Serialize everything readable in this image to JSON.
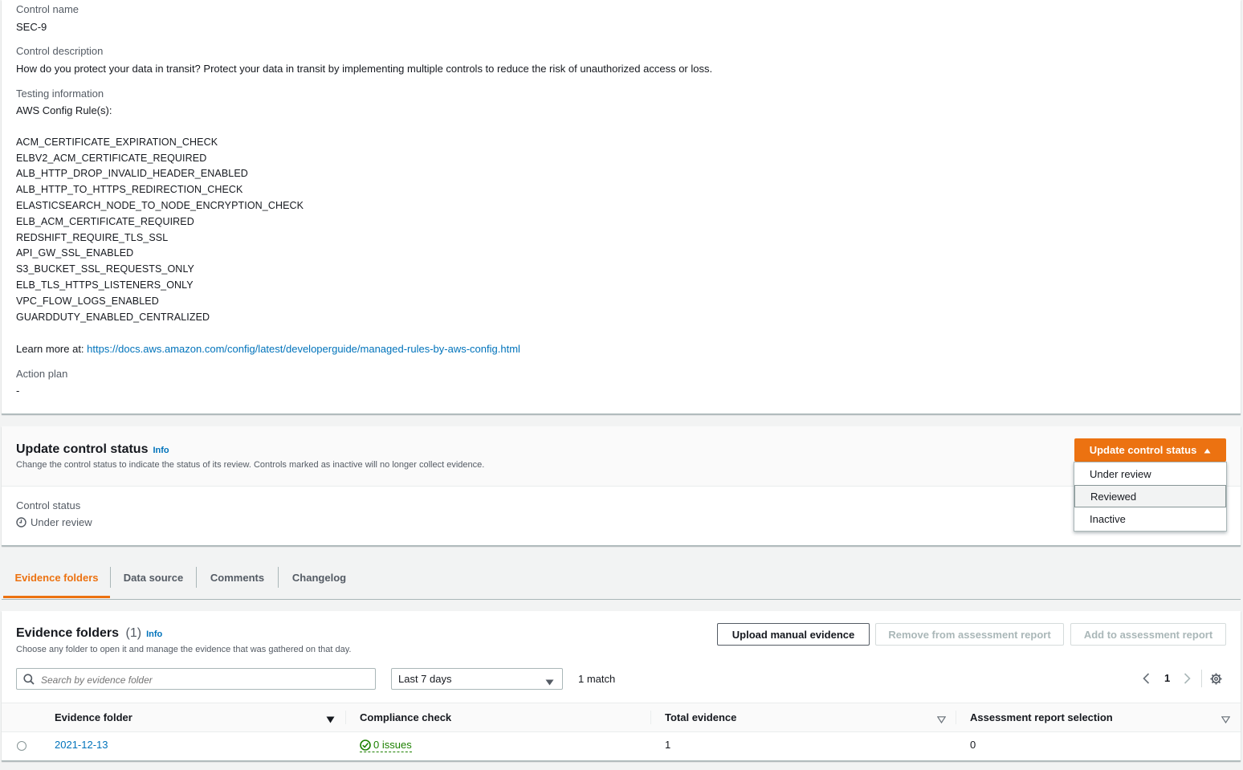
{
  "details": {
    "control_name_label": "Control name",
    "control_name": "SEC-9",
    "description_label": "Control description",
    "description": "How do you protect your data in transit? Protect your data in transit by implementing multiple controls to reduce the risk of unauthorized access or loss.",
    "testing_label": "Testing information",
    "config_rules_label": "AWS Config Rule(s):",
    "rules": [
      "ACM_CERTIFICATE_EXPIRATION_CHECK",
      "ELBV2_ACM_CERTIFICATE_REQUIRED",
      "ALB_HTTP_DROP_INVALID_HEADER_ENABLED",
      "ALB_HTTP_TO_HTTPS_REDIRECTION_CHECK",
      "ELASTICSEARCH_NODE_TO_NODE_ENCRYPTION_CHECK",
      "ELB_ACM_CERTIFICATE_REQUIRED",
      "REDSHIFT_REQUIRE_TLS_SSL",
      "API_GW_SSL_ENABLED",
      "S3_BUCKET_SSL_REQUESTS_ONLY",
      "ELB_TLS_HTTPS_LISTENERS_ONLY",
      "VPC_FLOW_LOGS_ENABLED",
      "GUARDDUTY_ENABLED_CENTRALIZED"
    ],
    "learn_more_prefix": "Learn more at: ",
    "learn_more_url": "https://docs.aws.amazon.com/config/latest/developerguide/managed-rules-by-aws-config.html",
    "action_plan_label": "Action plan",
    "action_plan": "-"
  },
  "status_panel": {
    "title": "Update control status",
    "info": "Info",
    "subtitle": "Change the control status to indicate the status of its review. Controls marked as inactive will no longer collect evidence.",
    "button_label": "Update control status",
    "menu_items": [
      "Under review",
      "Reviewed",
      "Inactive"
    ],
    "status_label": "Control status",
    "status_value": "Under review"
  },
  "tabs": [
    "Evidence folders",
    "Data source",
    "Comments",
    "Changelog"
  ],
  "evidence": {
    "title": "Evidence folders",
    "count": "(1)",
    "info": "Info",
    "subtitle": "Choose any folder to open it and manage the evidence that was gathered on that day.",
    "upload_button": "Upload manual evidence",
    "remove_button": "Remove from assessment report",
    "add_button": "Add to assessment report",
    "search_placeholder": "Search by evidence folder",
    "date_filter": "Last 7 days",
    "match_count": "1 match",
    "page_number": "1",
    "columns": [
      "Evidence folder",
      "Compliance check",
      "Total evidence",
      "Assessment report selection"
    ],
    "rows": [
      {
        "folder": "2021-12-13",
        "compliance": "0 issues",
        "total": "1",
        "selection": "0"
      }
    ]
  },
  "colors": {
    "accent": "#ec7211",
    "link": "#0073bb",
    "success": "#1d8102"
  }
}
